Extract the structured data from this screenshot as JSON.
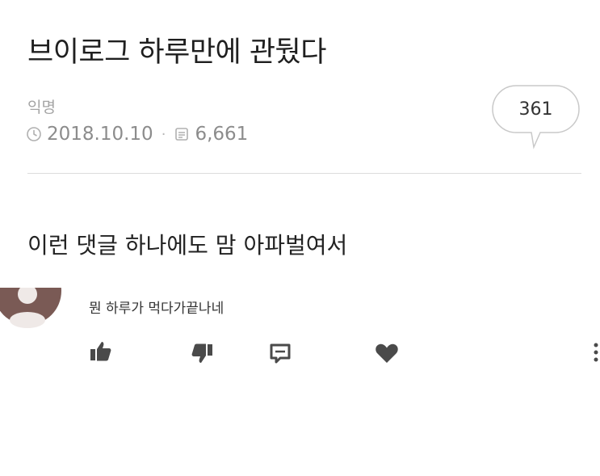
{
  "post": {
    "title": "브이로그 하루만에 관뒀다",
    "author": "익명",
    "date": "2018.10.10",
    "views": "6,661",
    "comment_count": "361",
    "body": "이런 댓글 하나에도 맘 아파벌여서"
  },
  "comment": {
    "text": "뭔 하루가 먹다가끝나네"
  },
  "icons": {
    "clock": "clock-icon",
    "views": "views-icon",
    "comment_bubble": "speech-bubble-icon",
    "like": "thumbs-up-icon",
    "dislike": "thumbs-down-icon",
    "reply": "reply-icon",
    "heart": "heart-icon",
    "more": "more-icon"
  },
  "colors": {
    "text": "#222222",
    "muted": "#a4a4a4",
    "icon": "#4a4a4a",
    "avatar": "#7a5a55"
  }
}
